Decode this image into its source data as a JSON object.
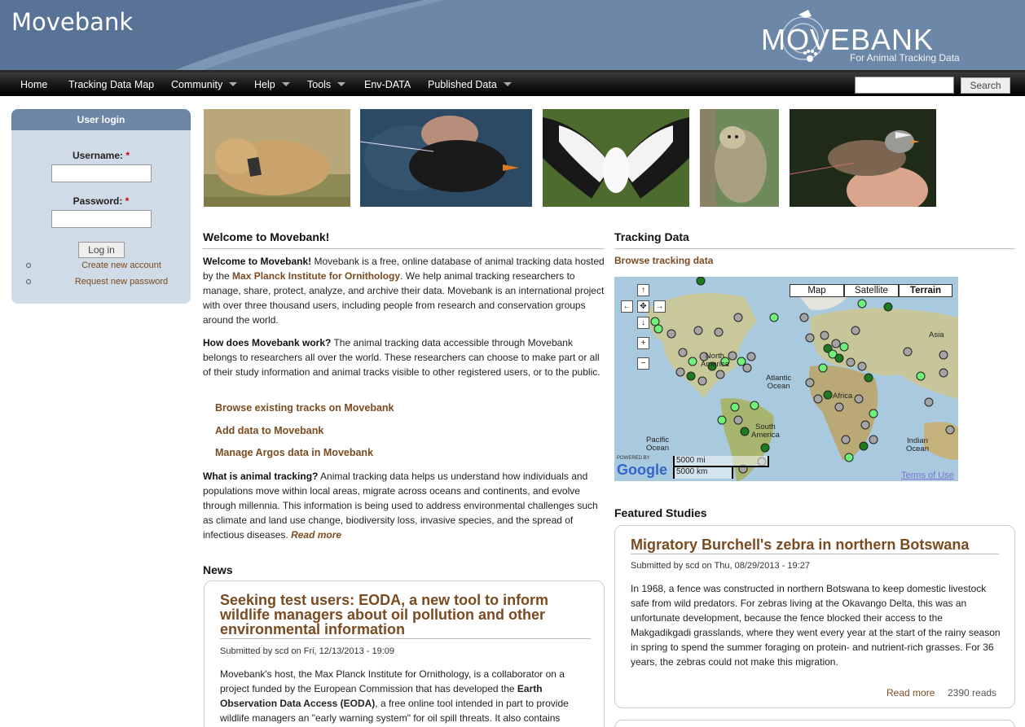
{
  "header": {
    "site_title": "Movebank",
    "logo_text": "MOVEBANK",
    "logo_subtitle": "For Animal Tracking Data"
  },
  "nav": {
    "items": [
      {
        "label": "Home",
        "dropdown": false
      },
      {
        "label": "Tracking Data Map",
        "dropdown": false
      },
      {
        "label": "Community",
        "dropdown": true
      },
      {
        "label": "Help",
        "dropdown": true
      },
      {
        "label": "Tools",
        "dropdown": true
      },
      {
        "label": "Env-DATA",
        "dropdown": false
      },
      {
        "label": "Published Data",
        "dropdown": true
      }
    ],
    "search_value": "",
    "search_button": "Search"
  },
  "login": {
    "title": "User login",
    "username_label": "Username:",
    "password_label": "Password:",
    "required_mark": "*",
    "username_value": "",
    "password_value": "",
    "login_button": "Log in",
    "links": [
      "Create new account",
      "Request new password"
    ]
  },
  "welcome": {
    "title": "Welcome to Movebank!",
    "p1_lead": "Welcome to Movebank!",
    "p1_a": " Movebank is a free, online database of animal tracking data hosted by the ",
    "p1_link": "Max Planck Institute for Ornithology",
    "p1_b": ". We help animal tracking researchers to manage, share, protect, analyze, and archive their data. Movebank is an international project with over three thousand users, including people from research and conservation groups around the world.",
    "p2_lead": "How does Movebank work?",
    "p2": " The animal tracking data accessible through Movebank belongs to researchers all over the world. These researchers can choose to make part or all of their study information and animal tracks visible to other registered users, or to the public.",
    "links": [
      "Browse existing tracks on Movebank",
      "Add data to Movebank",
      "Manage Argos data in Movebank"
    ],
    "p3_lead": "What is animal tracking?",
    "p3": " Animal tracking data helps us understand how individuals and populations move within local areas, migrate across oceans and continents, and evolve through millennia. This information is being used to address environmental challenges such as climate and land use change, biodiversity loss, invasive species, and the spread of infectious diseases.",
    "p3_more": "Read more"
  },
  "news": {
    "title": "News",
    "item_title": "Seeking test users: EODA, a new tool to inform wildlife managers about oil pollution and other environmental information",
    "submitted": "Submitted by scd on Fri, 12/13/2013 - 19:09",
    "body_a": "Movebank's host, the Max Planck Institute for Ornithology, is a collaborator on a project funded by the European Commission that has developed the ",
    "body_bold": "Earth Observation Data Access (EODA)",
    "body_b": ", a free online tool intended in part to provide wildlife managers an \"early warning system\" for oil spill threats. It also contains"
  },
  "tracking": {
    "title": "Tracking Data",
    "browse_link": "Browse tracking data",
    "map_types": [
      "Map",
      "Satellite",
      "Terrain"
    ],
    "selected_map_type": "Terrain",
    "labels": {
      "north_america": "North\nAmerica",
      "atlantic": "Atlantic\nOcean",
      "africa": "Africa",
      "asia": "Asia",
      "south_america": "South\nAmerica",
      "pacific": "Pacific\nOcean",
      "indian": "Indian\nOcean"
    },
    "powered_by": "POWERED BY",
    "google": "Google",
    "scale_mi": "5000 mi",
    "scale_km": "5000 km",
    "terms": "Terms of Use"
  },
  "featured": {
    "title": "Featured Studies",
    "item_title": "Migratory Burchell's zebra in northern Botswana",
    "submitted": "Submitted by scd on Thu, 08/29/2013 - 19:27",
    "body": "In 1968, a fence was constructed in northern Botswana to keep domestic livestock safe from wild predators. For zebras living at the Okavango Delta, this was an unfortunate development, because the fence blocked their access to the Makgadikgadi grasslands, where they went every year at the start of the rainy season in spring to spend the summer foraging on protein- and nutrient-rich grasses. For 36 years, the zebras could not make this migration.",
    "read_more": "Read more",
    "reads": "2390 reads"
  },
  "colors": {
    "brand_blue": "#6c87a8",
    "link_brown": "#7a4b20",
    "marker_light": "#6ef07a",
    "marker_dark": "#1e7a1e",
    "marker_gray": "#a4a4a4"
  }
}
